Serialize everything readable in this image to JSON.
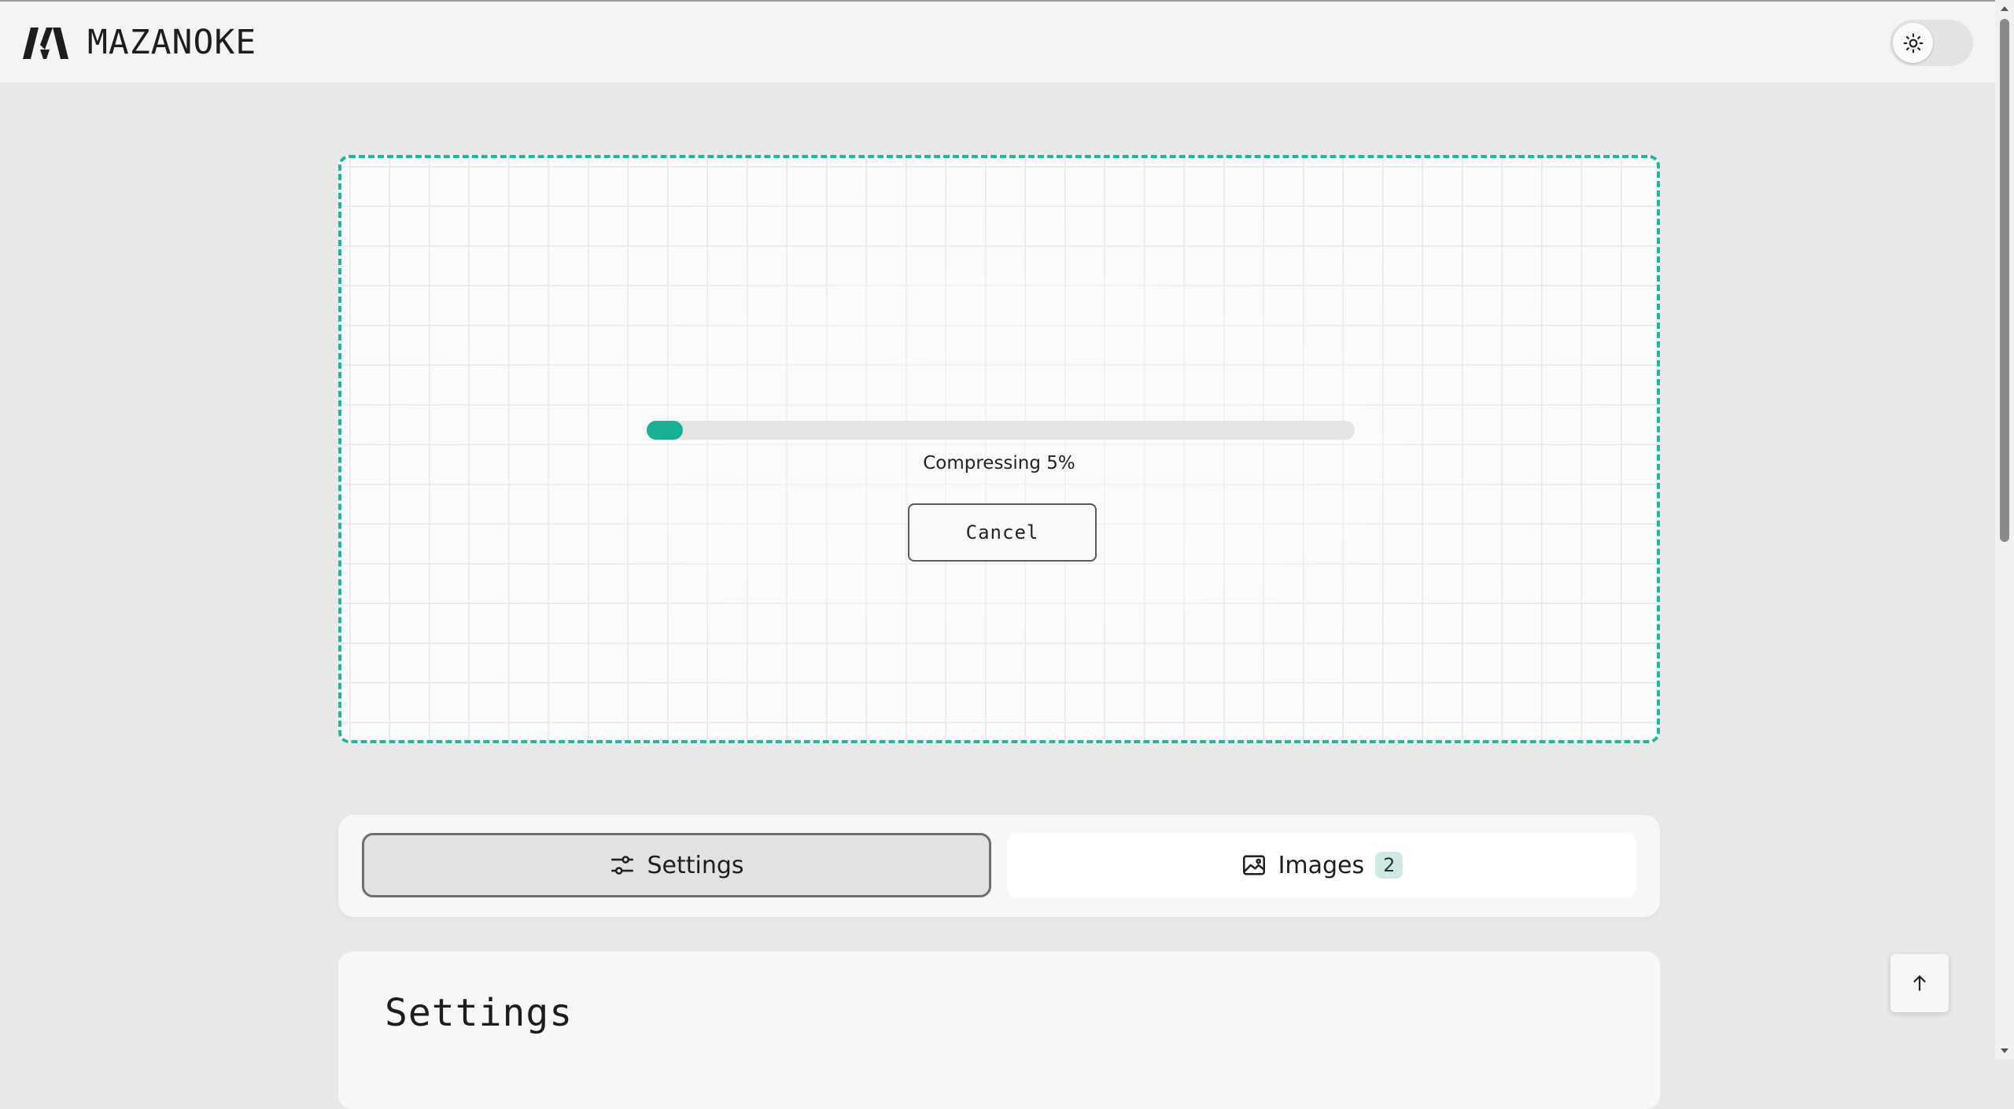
{
  "app": {
    "brand": "MAZANOKE"
  },
  "header": {
    "theme_toggle_icon": "sun-icon"
  },
  "dropzone": {
    "progress_percent": 5,
    "status_text": "Compressing 5%",
    "cancel_label": "Cancel"
  },
  "tabs": [
    {
      "label": "Settings",
      "icon": "sliders-icon",
      "active": true
    },
    {
      "label": "Images",
      "icon": "image-icon",
      "badge": "2",
      "active": false
    }
  ],
  "settings": {
    "title": "Settings",
    "description": ""
  },
  "colors": {
    "accent": "#17b097",
    "dropzone_border": "#1fb59f",
    "page_bg": "#e8e8e8"
  },
  "scroll_top_icon": "arrow-up-icon"
}
